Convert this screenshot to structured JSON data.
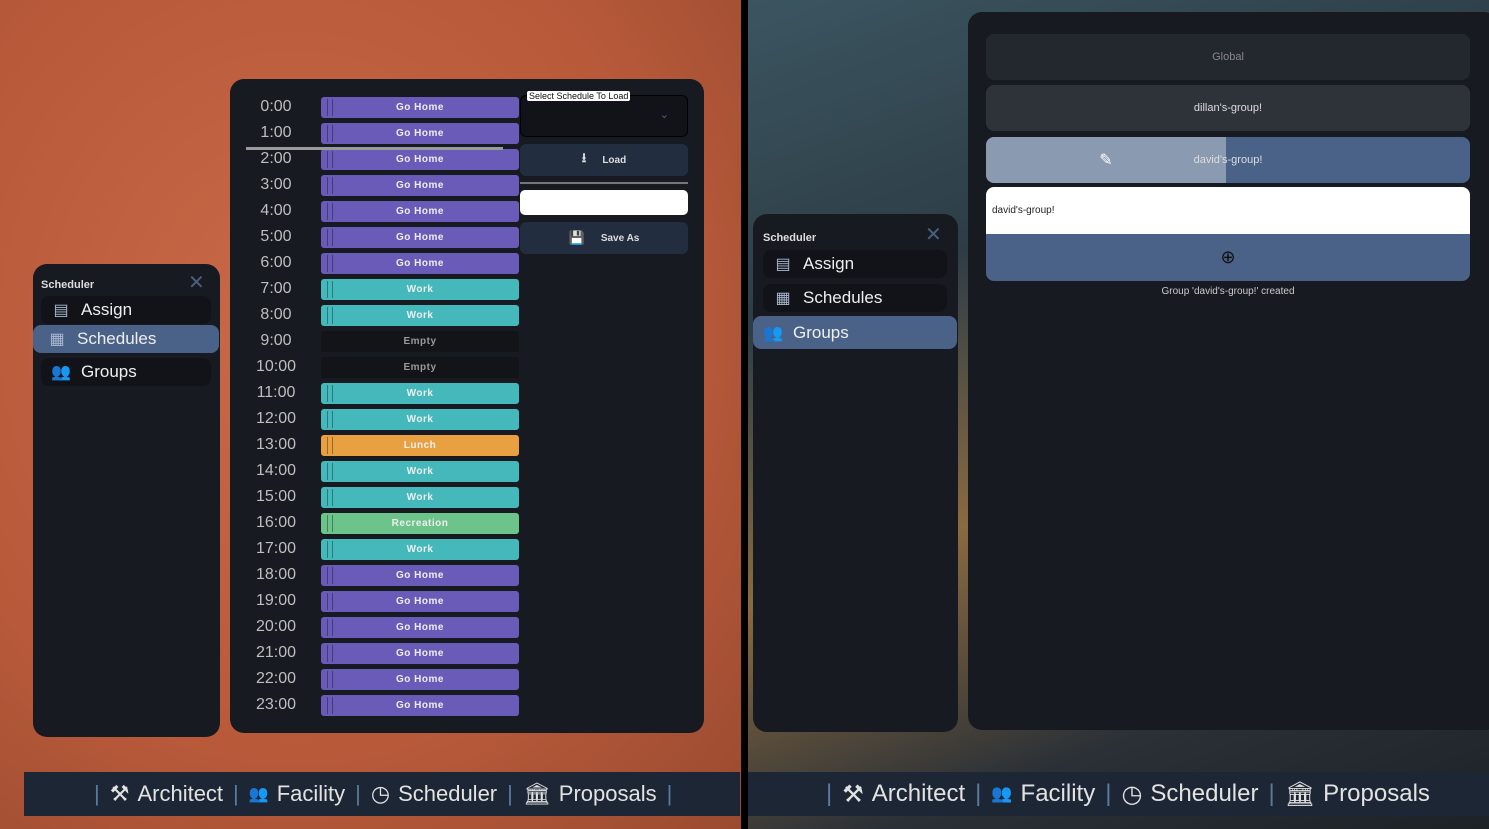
{
  "left": {
    "sidebar": {
      "title": "Scheduler",
      "items": [
        {
          "label": "Assign",
          "icon": "clipboard-icon"
        },
        {
          "label": "Schedules",
          "icon": "calendar-icon",
          "active": true
        },
        {
          "label": "Groups",
          "icon": "people-icon"
        }
      ]
    },
    "schedule": {
      "rows": [
        {
          "time": "0:00",
          "activity": "Go Home"
        },
        {
          "time": "1:00",
          "activity": "Go Home"
        },
        {
          "time": "2:00",
          "activity": "Go Home"
        },
        {
          "time": "3:00",
          "activity": "Go Home"
        },
        {
          "time": "4:00",
          "activity": "Go Home"
        },
        {
          "time": "5:00",
          "activity": "Go Home"
        },
        {
          "time": "6:00",
          "activity": "Go Home"
        },
        {
          "time": "7:00",
          "activity": "Work"
        },
        {
          "time": "8:00",
          "activity": "Work"
        },
        {
          "time": "9:00",
          "activity": "Empty"
        },
        {
          "time": "10:00",
          "activity": "Empty"
        },
        {
          "time": "11:00",
          "activity": "Work"
        },
        {
          "time": "12:00",
          "activity": "Work"
        },
        {
          "time": "13:00",
          "activity": "Lunch"
        },
        {
          "time": "14:00",
          "activity": "Work"
        },
        {
          "time": "15:00",
          "activity": "Work"
        },
        {
          "time": "16:00",
          "activity": "Recreation"
        },
        {
          "time": "17:00",
          "activity": "Work"
        },
        {
          "time": "18:00",
          "activity": "Go Home"
        },
        {
          "time": "19:00",
          "activity": "Go Home"
        },
        {
          "time": "20:00",
          "activity": "Go Home"
        },
        {
          "time": "21:00",
          "activity": "Go Home"
        },
        {
          "time": "22:00",
          "activity": "Go Home"
        },
        {
          "time": "23:00",
          "activity": "Go Home"
        }
      ],
      "colors": {
        "Go Home": "#6b5bb8",
        "Work": "#45b8bc",
        "Empty": "#121418",
        "Lunch": "#e8a040",
        "Recreation": "#6cc48a"
      },
      "select_label": "Select Schedule To Load",
      "select_value": "",
      "load_label": "Load",
      "name_input_value": "",
      "save_as_label": "Save As"
    },
    "bottom_bar": [
      "Architect",
      "Facility",
      "Scheduler",
      "Proposals"
    ]
  },
  "right": {
    "sidebar": {
      "title": "Scheduler",
      "items": [
        {
          "label": "Assign",
          "icon": "clipboard-icon"
        },
        {
          "label": "Schedules",
          "icon": "calendar-icon"
        },
        {
          "label": "Groups",
          "icon": "people-icon",
          "active": true
        }
      ]
    },
    "groups": [
      {
        "label": "Global"
      },
      {
        "label": "dillan's-group!"
      },
      {
        "label": "david's-group!",
        "selected": true
      }
    ],
    "group_name_input_value": "david's-group!",
    "status": "Group 'david's-group!' created",
    "bottom_bar": [
      "Architect",
      "Facility",
      "Scheduler",
      "Proposals"
    ]
  }
}
